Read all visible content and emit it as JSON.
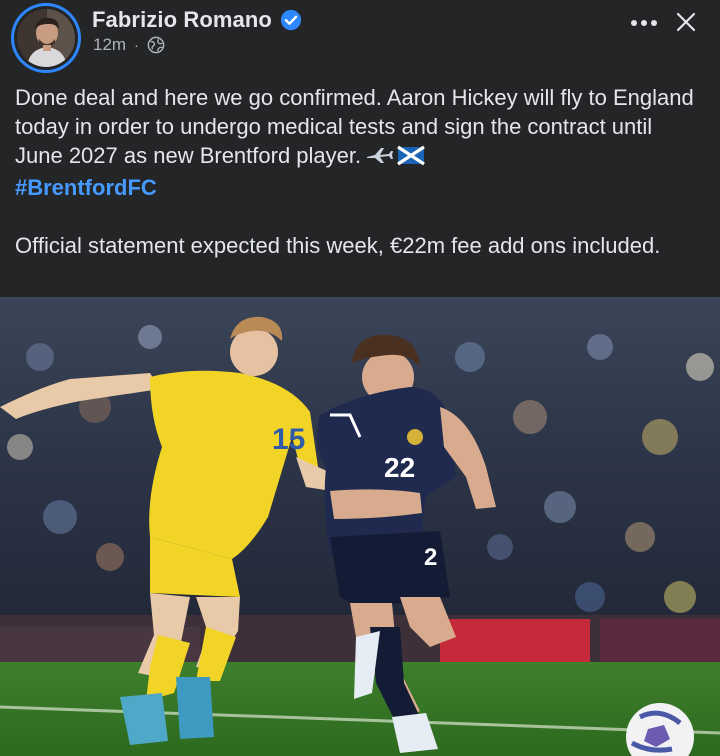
{
  "post": {
    "author": {
      "name": "Fabrizio Romano",
      "verified": true,
      "avatar": "profile-photo"
    },
    "meta": {
      "time": "12m",
      "separator": "·",
      "audience_icon": "globe-icon"
    },
    "actions": {
      "more_icon": "more-horizontal-icon",
      "close_icon": "close-icon"
    },
    "text": {
      "line1": "Done deal and here we go confirmed. Aaron Hickey will fly to England today in order to undergo medical tests and sign the contract until June 2027 as new Brentford player.",
      "emojis": "✈️🏴󠁧󠁢󠁳󠁣󠁴󠁿",
      "hashtag": "#BrentfordFC",
      "line2": "Official statement expected this week, €22m fee add ons included."
    },
    "photo": {
      "description_icon": "football-match-photo",
      "shirt_numbers": [
        "15",
        "22",
        "2"
      ]
    }
  },
  "colors": {
    "background": "#242526",
    "text": "#e4e6eb",
    "secondary_text": "#b0b3b8",
    "link": "#4599ff",
    "verified_badge": "#2d88ff"
  }
}
